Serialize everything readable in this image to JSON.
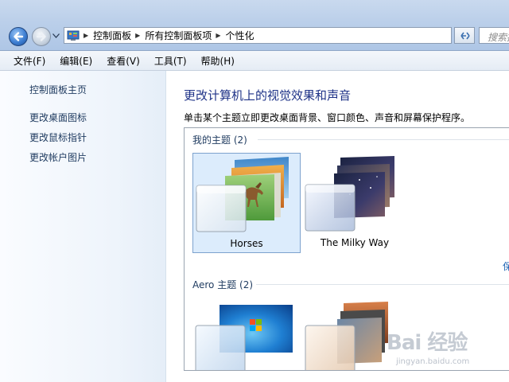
{
  "address_bar": {
    "crumbs": [
      "控制面板",
      "所有控制面板项",
      "个性化"
    ],
    "search_placeholder": "搜索控"
  },
  "menu": [
    "文件(F)",
    "编辑(E)",
    "查看(V)",
    "工具(T)",
    "帮助(H)"
  ],
  "sidebar": {
    "links": [
      "控制面板主页",
      "更改桌面图标",
      "更改鼠标指针",
      "更改帐户图片"
    ]
  },
  "main": {
    "title": "更改计算机上的视觉效果和声音",
    "subtitle": "单击某个主题立即更改桌面背景、窗口颜色、声音和屏幕保护程序。",
    "my_themes": {
      "header": "我的主题 (2)",
      "themes": [
        "Horses",
        "The Milky Way"
      ],
      "more_link": "保"
    },
    "aero_themes": {
      "header": "Aero 主题 (2)"
    }
  },
  "watermark": {
    "main": "Bai 经验",
    "sub": "jingyan.baidu.com"
  },
  "colors": {
    "title_blue": "#1e3287",
    "selection_bg": "#dcecfc",
    "selection_border": "#7da2ce"
  },
  "icons": [
    "back-arrow-icon",
    "forward-arrow-icon",
    "recent-pages-icon",
    "control-panel-icon",
    "breadcrumb-chevron-icon",
    "refresh-icon"
  ]
}
